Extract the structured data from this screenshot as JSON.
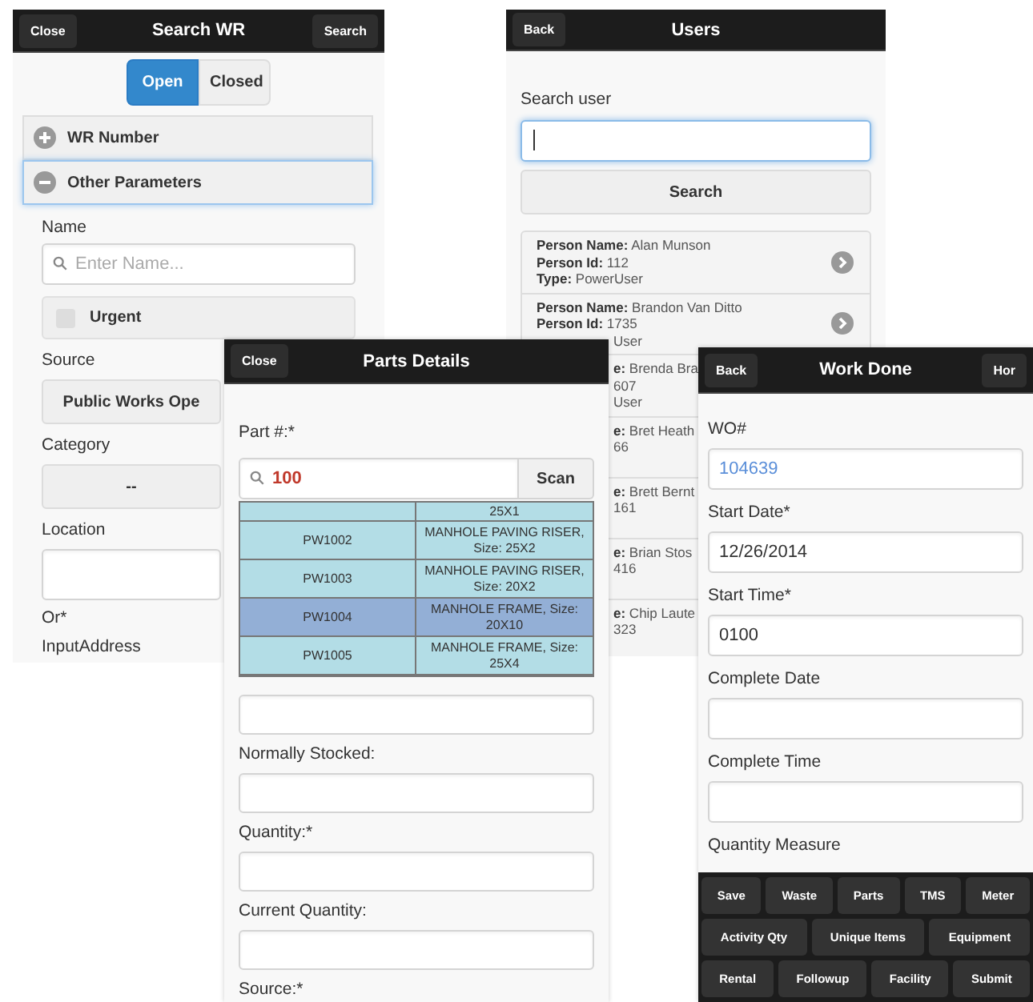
{
  "search_wr": {
    "header": {
      "left_button": "Close",
      "title": "Search WR",
      "right_button": "Search"
    },
    "tabs": [
      {
        "label": "Open",
        "selected": true
      },
      {
        "label": "Closed",
        "selected": false
      }
    ],
    "sections": [
      {
        "label": "WR Number",
        "expanded": false,
        "focused": false
      },
      {
        "label": "Other Parameters",
        "expanded": true,
        "focused": true
      }
    ],
    "fields": [
      {
        "kind": "search",
        "label": "Name",
        "placeholder": "Enter Name..."
      },
      {
        "kind": "checkbox",
        "label": "Urgent",
        "checked": false
      },
      {
        "kind": "select",
        "label": "Source",
        "value": "Public Works Ope"
      },
      {
        "kind": "select",
        "label": "Category",
        "value": "--"
      },
      {
        "kind": "textarea",
        "label": "Location"
      },
      {
        "kind": "label",
        "label": "Or*"
      },
      {
        "kind": "label",
        "label": "InputAddress"
      }
    ]
  },
  "users": {
    "header": {
      "left_button": "Back",
      "title": "Users"
    },
    "search": {
      "label": "Search user",
      "button": "Search"
    },
    "rows": [
      {
        "kind": "full",
        "lines": [
          {
            "kind": "whole",
            "text": "**Person Name:** Alan Munson"
          },
          {
            "kind": "whole",
            "text": "**Person Id:** 112"
          },
          {
            "kind": "whole",
            "text": "**Type:** PowerUser"
          }
        ]
      },
      {
        "kind": "full",
        "lines": [
          {
            "kind": "whole",
            "text": "**Person Name:** Brandon Van Ditto"
          },
          {
            "kind": "whole",
            "text": "**Person Id:** 1735"
          },
          {
            "kind": "fragment",
            "text": "User"
          }
        ]
      },
      {
        "kind": "partial",
        "lines": [
          {
            "kind": "fragment",
            "text": "**e:** Brenda Bra"
          },
          {
            "kind": "fragment",
            "text": "607"
          },
          {
            "kind": "fragment",
            "text": "User"
          }
        ]
      },
      {
        "kind": "partial",
        "lines": [
          {
            "kind": "fragment",
            "text": "**e:** Bret Heath"
          },
          {
            "kind": "fragment",
            "text": "66"
          }
        ]
      },
      {
        "kind": "partial",
        "lines": [
          {
            "kind": "fragment",
            "text": "**e:** Brett Bernt"
          },
          {
            "kind": "fragment",
            "text": "161"
          }
        ]
      },
      {
        "kind": "partial",
        "lines": [
          {
            "kind": "fragment",
            "text": "**e:** Brian Stos"
          },
          {
            "kind": "fragment",
            "text": "416"
          }
        ]
      },
      {
        "kind": "partial",
        "lines": [
          {
            "kind": "fragment",
            "text": "**e:** Chip Laute"
          },
          {
            "kind": "fragment",
            "text": "323"
          }
        ]
      }
    ]
  },
  "parts_details": {
    "header": {
      "left_button": "Close",
      "title": "Parts Details"
    },
    "part": {
      "label": "Part #:*",
      "value": "100",
      "button": "Scan"
    },
    "results": [
      {
        "description": "25X1",
        "selected": false
      },
      {
        "part": "PW1002",
        "description": "MANHOLE PAVING RISER, Size: 25X2",
        "selected": false
      },
      {
        "part": "PW1003",
        "description": "MANHOLE PAVING RISER, Size: 20X2",
        "selected": false
      },
      {
        "part": "PW1004",
        "description": "MANHOLE FRAME, Size: 20X10",
        "selected": true
      },
      {
        "part": "PW1005",
        "description": "MANHOLE FRAME, Size: 25X4",
        "selected": false
      }
    ],
    "fields": [
      {
        "kind": "input"
      },
      {
        "kind": "label",
        "label": "Normally Stocked:"
      },
      {
        "kind": "input"
      },
      {
        "kind": "label",
        "label": "Quantity:*"
      },
      {
        "kind": "input"
      },
      {
        "kind": "label",
        "label": "Current Quantity:"
      },
      {
        "kind": "input"
      },
      {
        "kind": "label",
        "label": "Source:*"
      }
    ]
  },
  "work_done": {
    "header": {
      "left_button": "Back",
      "title": "Work Done",
      "right_button": "Hor"
    },
    "fields": [
      {
        "kind": "link",
        "label": "WO#",
        "value": "104639"
      },
      {
        "kind": "text",
        "label": "Start Date*",
        "value": "12/26/2014"
      },
      {
        "kind": "text",
        "label": "Start Time*",
        "value": "0100"
      },
      {
        "kind": "text",
        "label": "Complete Date"
      },
      {
        "kind": "text",
        "label": "Complete Time"
      },
      {
        "kind": "label",
        "label": "Quantity Measure"
      }
    ],
    "toolbar": [
      {
        "buttons": [
          "Save",
          "Waste",
          "Parts",
          "TMS",
          "Meter"
        ]
      },
      {
        "buttons": [
          "Activity Qty",
          "Unique Items",
          "Equipment"
        ]
      },
      {
        "buttons": [
          "Rental",
          "Followup",
          "Facility",
          "Submit"
        ]
      }
    ]
  }
}
